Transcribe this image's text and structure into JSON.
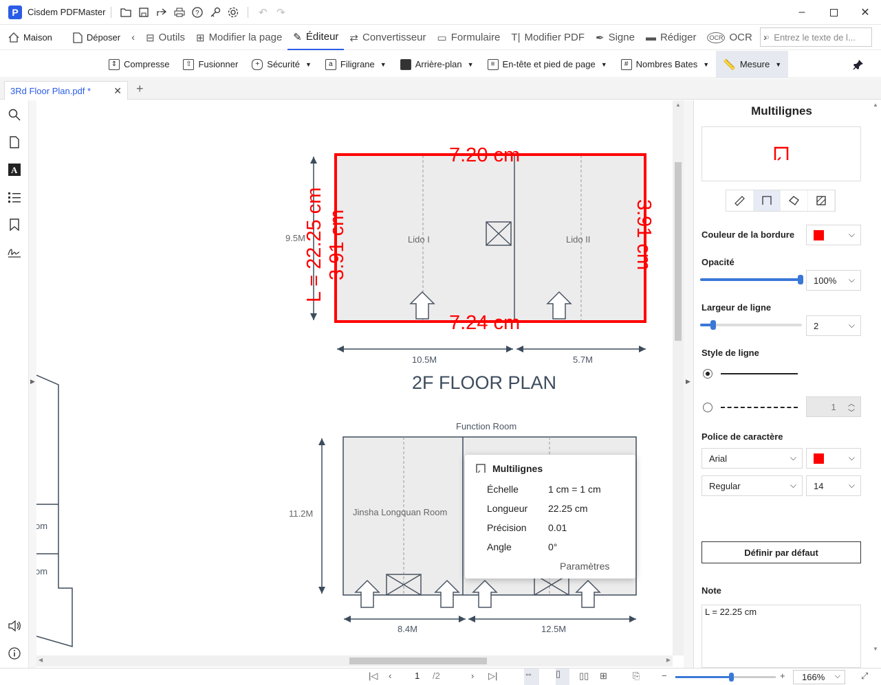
{
  "app": {
    "title": "Cisdem PDFMaster"
  },
  "menu": {
    "home": "Maison",
    "upload": "Déposer",
    "tools": "Outils",
    "modify_page": "Modifier la page",
    "editor": "Éditeur",
    "converter": "Convertisseur",
    "form": "Formulaire",
    "modify_pdf": "Modifier PDF",
    "sign": "Signe",
    "redact": "Rédiger",
    "ocr": "OCR",
    "search_placeholder": "Entrez le texte de l..."
  },
  "toolbar": {
    "compress": "Compresse",
    "merge": "Fusionner",
    "security": "Sécurité",
    "watermark": "Filigrane",
    "background": "Arrière-plan",
    "header_footer": "En-tête et pied de page",
    "bates": "Nombres Bates",
    "measure": "Mesure"
  },
  "tab": {
    "name": "3Rd Floor Plan.pdf *"
  },
  "plan": {
    "m_top": "7.20 cm",
    "m_bottom": "7.24 cm",
    "m_left": "3.91 cm",
    "m_right": "3.91 cm",
    "m_vertical": "L = 22.25 cm",
    "h_left": "9.5M",
    "room1": "Lido I",
    "room2": "Lido II",
    "w1": "10.5M",
    "w2": "5.7M",
    "floor_title": "2F FLOOR PLAN",
    "function_room": "Function Room",
    "h2": "11.2M",
    "room3": "Jinsha Longquan Room",
    "w3": "8.4M",
    "w4": "12.5M",
    "frag1": "om",
    "frag2": "om"
  },
  "popup": {
    "title": "Multilignes",
    "scale_label": "Échelle",
    "scale": "1 cm = 1 cm",
    "length_label": "Longueur",
    "length": "22.25 cm",
    "precision_label": "Précision",
    "precision": "0.01",
    "angle_label": "Angle",
    "angle": "0°",
    "settings": "Paramètres"
  },
  "panel": {
    "title": "Multilignes",
    "border_color_label": "Couleur de la bordure",
    "border_color": "#ff0000",
    "opacity_label": "Opacité",
    "opacity": "100%",
    "opacity_value": 1.0,
    "line_width_label": "Largeur de ligne",
    "line_width": "2",
    "line_style_label": "Style de ligne",
    "dash_value": "1",
    "font_label": "Police de caractère",
    "font_family": "Arial",
    "font_style": "Regular",
    "font_size": "14",
    "font_color": "#ff0000",
    "default_btn": "Définir par défaut",
    "note_label": "Note",
    "note": "L = 22.25 cm"
  },
  "status": {
    "page": "1",
    "total": "/2",
    "zoom": "166%"
  }
}
